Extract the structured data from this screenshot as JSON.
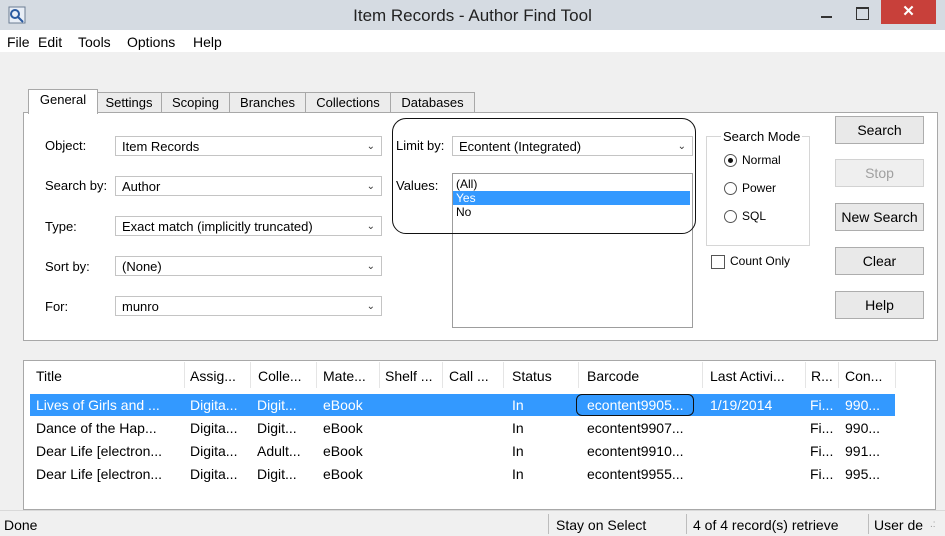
{
  "window": {
    "title": "Item Records - Author Find Tool",
    "close_glyph": "✕"
  },
  "menu": [
    "File",
    "Edit",
    "Tools",
    "Options",
    "Help"
  ],
  "tabs": [
    "General",
    "Settings",
    "Scoping",
    "Branches",
    "Collections",
    "Databases"
  ],
  "form": {
    "object_label": "Object:",
    "object_value": "Item Records",
    "search_by_label": "Search by:",
    "search_by_value": "Author",
    "type_label": "Type:",
    "type_value": "Exact match (implicitly truncated)",
    "sort_by_label": "Sort by:",
    "sort_by_value": "(None)",
    "for_label": "For:",
    "for_value": "munro",
    "limit_by_label": "Limit by:",
    "limit_by_value": "Econtent (Integrated)",
    "values_label": "Values:",
    "values_options": [
      "(All)",
      "Yes",
      "No"
    ],
    "values_selected": "Yes"
  },
  "search_mode": {
    "label": "Search Mode",
    "options": [
      "Normal",
      "Power",
      "SQL"
    ],
    "selected": "Normal"
  },
  "count_only_label": "Count Only",
  "buttons": {
    "search": "Search",
    "stop": "Stop",
    "new_search": "New Search",
    "clear": "Clear",
    "help": "Help"
  },
  "results": {
    "columns": [
      "Title",
      "Assig...",
      "Colle...",
      "Mate...",
      "Shelf ...",
      "Call ...",
      "Status",
      "Barcode",
      "Last Activi...",
      "R...",
      "Con..."
    ],
    "rows": [
      [
        "Lives of Girls and ...",
        "Digita...",
        "Digit...",
        "eBook",
        "",
        "",
        "In",
        "econtent9905...",
        "1/19/2014",
        "Fi...",
        "990..."
      ],
      [
        "Dance of the Hap...",
        "Digita...",
        "Digit...",
        "eBook",
        "",
        "",
        "In",
        "econtent9907...",
        "",
        "Fi...",
        "990..."
      ],
      [
        "Dear Life [electron...",
        "Digita...",
        "Adult...",
        "eBook",
        "",
        "",
        "In",
        "econtent9910...",
        "",
        "Fi...",
        "991..."
      ],
      [
        "Dear Life [electron...",
        "Digita...",
        "Digit...",
        "eBook",
        "",
        "",
        "In",
        "econtent9955...",
        "",
        "Fi...",
        "995..."
      ]
    ],
    "selected_row": 0
  },
  "status": {
    "left": "Done",
    "mode": "Stay on Select",
    "records": "4 of 4 record(s) retrieve",
    "user": "User de"
  },
  "colors": {
    "selection": "#3399ff",
    "close": "#c8403a"
  }
}
